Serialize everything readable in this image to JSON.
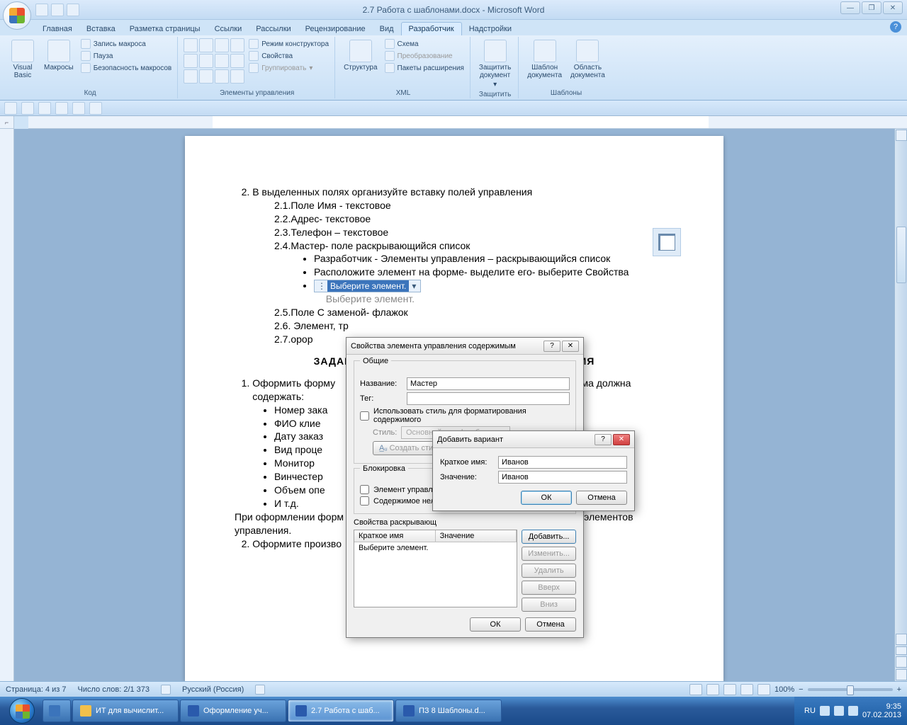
{
  "window": {
    "title": "2.7 Работа с шаблонами.docx - Microsoft Word",
    "min": "—",
    "max": "❐",
    "close": "✕"
  },
  "tabs": {
    "items": [
      "Главная",
      "Вставка",
      "Разметка страницы",
      "Ссылки",
      "Рассылки",
      "Рецензирование",
      "Вид",
      "Разработчик",
      "Надстройки"
    ],
    "active_index": 7
  },
  "ribbon": {
    "code": {
      "label": "Код",
      "visual_basic": "Visual\nBasic",
      "macros": "Макросы",
      "record": "Запись макроса",
      "pause": "Пауза",
      "security": "Безопасность макросов"
    },
    "controls": {
      "label": "Элементы управления",
      "design_mode": "Режим конструктора",
      "properties": "Свойства",
      "group": "Группировать"
    },
    "xml": {
      "label": "XML",
      "structure": "Структура",
      "schema": "Схема",
      "transform": "Преобразование",
      "expansion": "Пакеты расширения"
    },
    "protect": {
      "label": "Защитить",
      "protect_doc": "Защитить\nдокумент"
    },
    "templates": {
      "label": "Шаблоны",
      "doc_template": "Шаблон\nдокумента",
      "doc_area": "Область\nдокумента"
    }
  },
  "document": {
    "item2": "В выделенных полях организуйте вставку полей управления",
    "i21": "2.1.Поле Имя - текстовое",
    "i22": "2.2.Адрес- текстовое",
    "i23": "2.3.Телефон – текстовое",
    "i24": "2.4.Мастер- поле раскрывающийся список",
    "b241": "Разработчик - Элементы управления – раскрывающийся список",
    "b242": "Расположите элемент на форме- выделите его- выберите Свойства",
    "dropdown_sel": "Выберите элемент.",
    "dropdown_gray": "Выберите элемент.",
    "i25": "2.5.Поле С заменой- флажок",
    "i26": "2.6. Элемент, тр",
    "i27": "2.7.орор",
    "zadanie": "ЗАДАН",
    "zadanie_right": "ИЯ",
    "task1a": "Оформить форму",
    "task1b": "ера. Форма должна",
    "task1c": "содержать:",
    "li": [
      "Номер зака",
      "ФИО клие",
      "Дату заказ",
      "Вид проце",
      "Монитор",
      "Винчестер",
      "Объем опе",
      "И т.д."
    ],
    "foot1": "При оформлении форм",
    "foot1b": "ые виды элементов",
    "foot2": "управления.",
    "foot3": "Оформите произво"
  },
  "dialog1": {
    "title": "Свойства элемента управления содержимым",
    "help": "?",
    "close": "✕",
    "general": "Общие",
    "name_label": "Название:",
    "name_value": "Мастер",
    "tag_label": "Тег:",
    "tag_value": "",
    "use_style": "Использовать стиль для форматирования содержимого",
    "style_label": "Стиль:",
    "style_value": "Основной шрифт абзаца",
    "create_style": "Создать сти",
    "lock": "Блокировка",
    "lock1": "Элемент управле",
    "lock2": "Содержимое нел",
    "listprops": "Свойства раскрывающ",
    "col1": "Краткое имя",
    "col2": "Значение",
    "listitem": "Выберите элемент.",
    "add": "Добавить...",
    "edit": "Изменить...",
    "del": "Удалить",
    "up": "Вверх",
    "down": "Вниз",
    "ok": "ОК",
    "cancel": "Отмена"
  },
  "dialog2": {
    "title": "Добавить вариант",
    "help": "?",
    "close": "✕",
    "short_label": "Краткое имя:",
    "short_value": "Иванов",
    "value_label": "Значение:",
    "value_value": "Иванов",
    "ok": "ОК",
    "cancel": "Отмена"
  },
  "statusbar": {
    "page": "Страница: 4 из 7",
    "words": "Число слов: 2/1 373",
    "lang": "Русский (Россия)",
    "zoom": "100%"
  },
  "taskbar": {
    "items": [
      "ИТ для вычислит...",
      "Оформление уч...",
      "2.7 Работа с шаб...",
      "ПЗ 8 Шаблоны.d..."
    ],
    "active_index": 2,
    "lang": "RU",
    "time": "9:35",
    "date": "07.02.2013"
  }
}
